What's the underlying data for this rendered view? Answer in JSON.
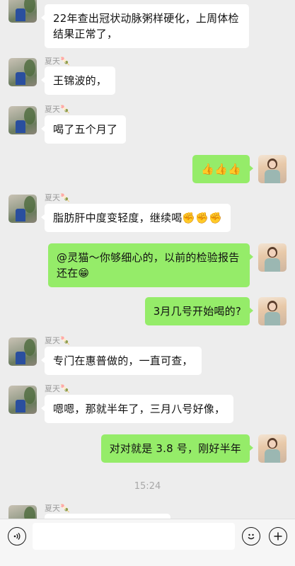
{
  "messages": [
    {
      "side": "left",
      "sender": "",
      "text": "22年查出冠状动脉粥样硬化，上周体检结果正常了，"
    },
    {
      "side": "left",
      "sender": "夏天🍡",
      "text": "王锦波的，"
    },
    {
      "side": "left",
      "sender": "夏天🍡",
      "text": "喝了五个月了"
    },
    {
      "side": "right",
      "text": "👍👍👍"
    },
    {
      "side": "left",
      "sender": "夏天🍡",
      "text": "脂肪肝中度变轻度，继续喝✊✊✊"
    },
    {
      "side": "right",
      "text": "@灵猫～你够细心的，以前的检验报告还在😁"
    },
    {
      "side": "right",
      "text": "3月几号开始喝的?"
    },
    {
      "side": "left",
      "sender": "夏天🍡",
      "text": "专门在惠普做的，一直可查，"
    },
    {
      "side": "left",
      "sender": "夏天🍡",
      "text": "嗯嗯，那就半年了，三月八号好像，"
    },
    {
      "side": "right",
      "text": "对对就是 3.8 号，刚好半年"
    },
    {
      "side": "left",
      "sender": "夏天🍡",
      "text": ""
    }
  ],
  "timestamp": "15:24",
  "input": {
    "placeholder": "",
    "value": ""
  },
  "icons": {
    "voice": "voice-icon",
    "emoji": "emoji-icon",
    "plus": "plus-icon"
  },
  "colors": {
    "background": "#ededed",
    "outgoing_bubble": "#95ec69",
    "incoming_bubble": "#ffffff"
  }
}
